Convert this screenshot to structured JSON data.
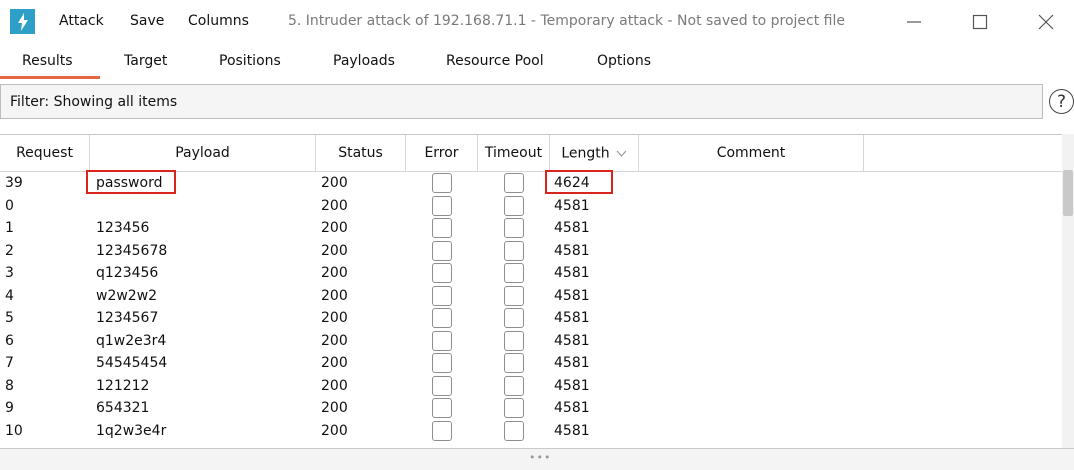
{
  "window": {
    "menu": [
      "Attack",
      "Save",
      "Columns"
    ],
    "title": "5. Intruder attack of 192.168.71.1 - Temporary attack - Not saved to project file"
  },
  "tabs": [
    "Results",
    "Target",
    "Positions",
    "Payloads",
    "Resource Pool",
    "Options"
  ],
  "active_tab": "Results",
  "filter": {
    "text": "Filter: Showing all items",
    "help_label": "?"
  },
  "table": {
    "columns": [
      "Request",
      "Payload",
      "Status",
      "Error",
      "Timeout",
      "Length",
      "Comment"
    ],
    "sorted_column": "Length",
    "rows": [
      {
        "request": "39",
        "payload": "password",
        "status": "200",
        "error": false,
        "timeout": false,
        "length": "4624",
        "comment": ""
      },
      {
        "request": "0",
        "payload": "",
        "status": "200",
        "error": false,
        "timeout": false,
        "length": "4581",
        "comment": ""
      },
      {
        "request": "1",
        "payload": "123456",
        "status": "200",
        "error": false,
        "timeout": false,
        "length": "4581",
        "comment": ""
      },
      {
        "request": "2",
        "payload": "12345678",
        "status": "200",
        "error": false,
        "timeout": false,
        "length": "4581",
        "comment": ""
      },
      {
        "request": "3",
        "payload": "q123456",
        "status": "200",
        "error": false,
        "timeout": false,
        "length": "4581",
        "comment": ""
      },
      {
        "request": "4",
        "payload": "w2w2w2",
        "status": "200",
        "error": false,
        "timeout": false,
        "length": "4581",
        "comment": ""
      },
      {
        "request": "5",
        "payload": "1234567",
        "status": "200",
        "error": false,
        "timeout": false,
        "length": "4581",
        "comment": ""
      },
      {
        "request": "6",
        "payload": "q1w2e3r4",
        "status": "200",
        "error": false,
        "timeout": false,
        "length": "4581",
        "comment": ""
      },
      {
        "request": "7",
        "payload": "54545454",
        "status": "200",
        "error": false,
        "timeout": false,
        "length": "4581",
        "comment": ""
      },
      {
        "request": "8",
        "payload": "121212",
        "status": "200",
        "error": false,
        "timeout": false,
        "length": "4581",
        "comment": ""
      },
      {
        "request": "9",
        "payload": "654321",
        "status": "200",
        "error": false,
        "timeout": false,
        "length": "4581",
        "comment": ""
      },
      {
        "request": "10",
        "payload": "1q2w3e4r",
        "status": "200",
        "error": false,
        "timeout": false,
        "length": "4581",
        "comment": ""
      }
    ]
  },
  "colors": {
    "accent": "#e8663d",
    "app_icon": "#2e9fc7",
    "highlight": "#d9241b"
  },
  "icons": [
    "burp-app-icon",
    "minimize-icon",
    "maximize-icon",
    "close-icon",
    "help-icon",
    "sort-chevron-icon"
  ]
}
